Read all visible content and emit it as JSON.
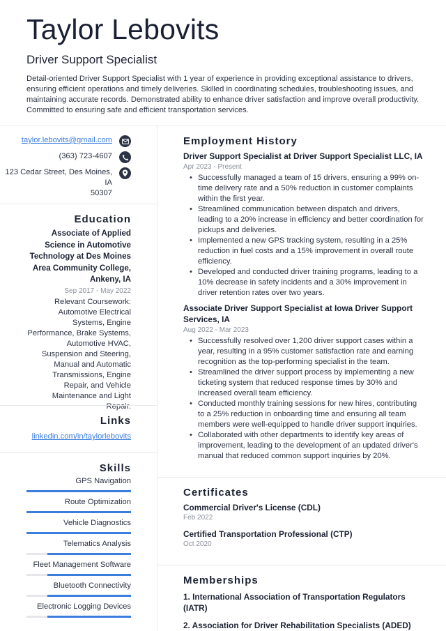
{
  "header": {
    "name": "Taylor Lebovits",
    "title": "Driver Support Specialist",
    "summary": "Detail-oriented Driver Support Specialist with 1 year of experience in providing exceptional assistance to drivers, ensuring efficient operations and timely deliveries. Skilled in coordinating schedules, troubleshooting issues, and maintaining accurate records. Demonstrated ability to enhance driver satisfaction and improve overall productivity. Committed to ensuring safe and efficient transportation services."
  },
  "contact": {
    "email": "taylor.lebovits@gmail.com",
    "email_icon": "envelope-icon",
    "phone": "(363) 723-4607",
    "phone_icon": "phone-icon",
    "address_line1": "123 Cedar Street, Des Moines, IA",
    "address_line2": "50307",
    "address_icon": "map-pin-icon"
  },
  "education": {
    "heading": "Education",
    "degree": "Associate of Applied Science in Automotive Technology at Des Moines Area Community College, Ankeny, IA",
    "dates": "Sep 2017 - May 2022",
    "description": "Relevant Coursework: Automotive Electrical Systems, Engine Performance, Brake Systems, Automotive HVAC, Suspension and Steering, Manual and Automatic Transmissions, Engine Repair, and Vehicle Maintenance and Light Repair."
  },
  "links": {
    "heading": "Links",
    "items": [
      "linkedin.com/in/taylorlebovits"
    ]
  },
  "skills": {
    "heading": "Skills",
    "accent_color": "#3b7ddd",
    "items": [
      {
        "name": "GPS Navigation",
        "level": 1.0
      },
      {
        "name": "Route Optimization",
        "level": 1.0
      },
      {
        "name": "Vehicle Diagnostics",
        "level": 1.0
      },
      {
        "name": "Telematics Analysis",
        "level": 0.8
      },
      {
        "name": "Fleet Management Software",
        "level": 0.8
      },
      {
        "name": "Bluetooth Connectivity",
        "level": 0.8
      },
      {
        "name": "Electronic Logging Devices",
        "level": 0.8
      }
    ]
  },
  "employment": {
    "heading": "Employment History",
    "jobs": [
      {
        "title": "Driver Support Specialist at Driver Support Specialist LLC, IA",
        "dates": "Apr 2023 - Present",
        "bullets": [
          "Successfully managed a team of 15 drivers, ensuring a 99% on-time delivery rate and a 50% reduction in customer complaints within the first year.",
          "Streamlined communication between dispatch and drivers, leading to a 20% increase in efficiency and better coordination for pickups and deliveries.",
          "Implemented a new GPS tracking system, resulting in a 25% reduction in fuel costs and a 15% improvement in overall route efficiency.",
          "Developed and conducted driver training programs, leading to a 10% decrease in safety incidents and a 30% improvement in driver retention rates over two years."
        ]
      },
      {
        "title": "Associate Driver Support Specialist at Iowa Driver Support Services, IA",
        "dates": "Aug 2022 - Mar 2023",
        "bullets": [
          "Successfully resolved over 1,200 driver support cases within a year, resulting in a 95% customer satisfaction rate and earning recognition as the top-performing specialist in the team.",
          "Streamlined the driver support process by implementing a new ticketing system that reduced response times by 30% and increased overall team efficiency.",
          "Conducted monthly training sessions for new hires, contributing to a 25% reduction in onboarding time and ensuring all team members were well-equipped to handle driver support inquiries.",
          "Collaborated with other departments to identify key areas of improvement, leading to the development of an updated driver's manual that reduced common support inquiries by 20%."
        ]
      }
    ]
  },
  "certificates": {
    "heading": "Certificates",
    "items": [
      {
        "title": "Commercial Driver's License (CDL)",
        "date": "Feb 2022"
      },
      {
        "title": "Certified Transportation Professional (CTP)",
        "date": "Oct 2020"
      }
    ]
  },
  "memberships": {
    "heading": "Memberships",
    "items": [
      "1. International Association of Transportation Regulators (IATR)",
      "2. Association for Driver Rehabilitation Specialists (ADED)"
    ]
  }
}
